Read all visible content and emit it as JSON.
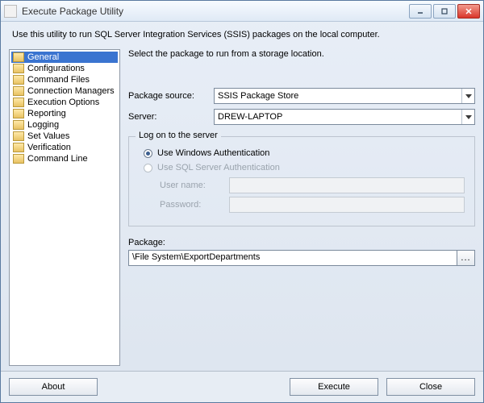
{
  "window": {
    "title": "Execute Package Utility"
  },
  "description": "Use this utility to run SQL Server Integration Services (SSIS) packages on the local computer.",
  "sidebar": {
    "items": [
      {
        "label": "General"
      },
      {
        "label": "Configurations"
      },
      {
        "label": "Command Files"
      },
      {
        "label": "Connection Managers"
      },
      {
        "label": "Execution Options"
      },
      {
        "label": "Reporting"
      },
      {
        "label": "Logging"
      },
      {
        "label": "Set Values"
      },
      {
        "label": "Verification"
      },
      {
        "label": "Command Line"
      }
    ],
    "selected_index": 0
  },
  "main": {
    "instruction": "Select the package to run from a storage location.",
    "package_source_label": "Package source:",
    "package_source_value": "SSIS Package Store",
    "server_label": "Server:",
    "server_value": "DREW-LAPTOP",
    "logon_group": "Log on to the server",
    "auth_windows": "Use Windows Authentication",
    "auth_sql": "Use SQL Server Authentication",
    "username_label": "User name:",
    "password_label": "Password:",
    "package_label": "Package:",
    "package_value": "\\File System\\ExportDepartments",
    "browse_label": "..."
  },
  "footer": {
    "about": "About",
    "execute": "Execute",
    "close": "Close"
  }
}
